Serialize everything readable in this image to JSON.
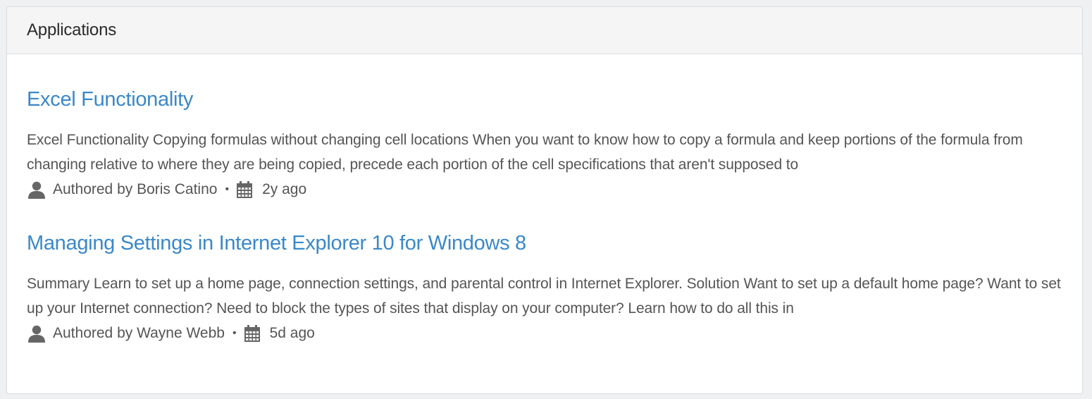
{
  "panel": {
    "title": "Applications"
  },
  "articles": [
    {
      "title": "Excel Functionality",
      "summary": "Excel Functionality Copying formulas without changing cell locations When you want to know how to copy a formula and keep portions of the formula from changing relative to where they are being copied, precede each portion of the cell specifications that aren't supposed to",
      "author": "Authored by Boris Catino",
      "separator": "•",
      "time": "2y ago"
    },
    {
      "title": "Managing Settings in Internet Explorer 10 for Windows 8",
      "summary": "Summary Learn to set up a home page, connection settings, and parental control in Internet Explorer. Solution Want to set up a default home page? Want to set up your Internet connection? Need to block the types of sites that display on your computer? Learn how to do all this in",
      "author": "Authored by Wayne Webb",
      "separator": "•",
      "time": "5d ago"
    }
  ],
  "icons": {
    "author": "user-icon",
    "date": "calendar-icon"
  },
  "colors": {
    "link": "#3a88c9",
    "text": "#555555",
    "header_bg": "#f5f5f5",
    "border": "#d9dcdf"
  }
}
